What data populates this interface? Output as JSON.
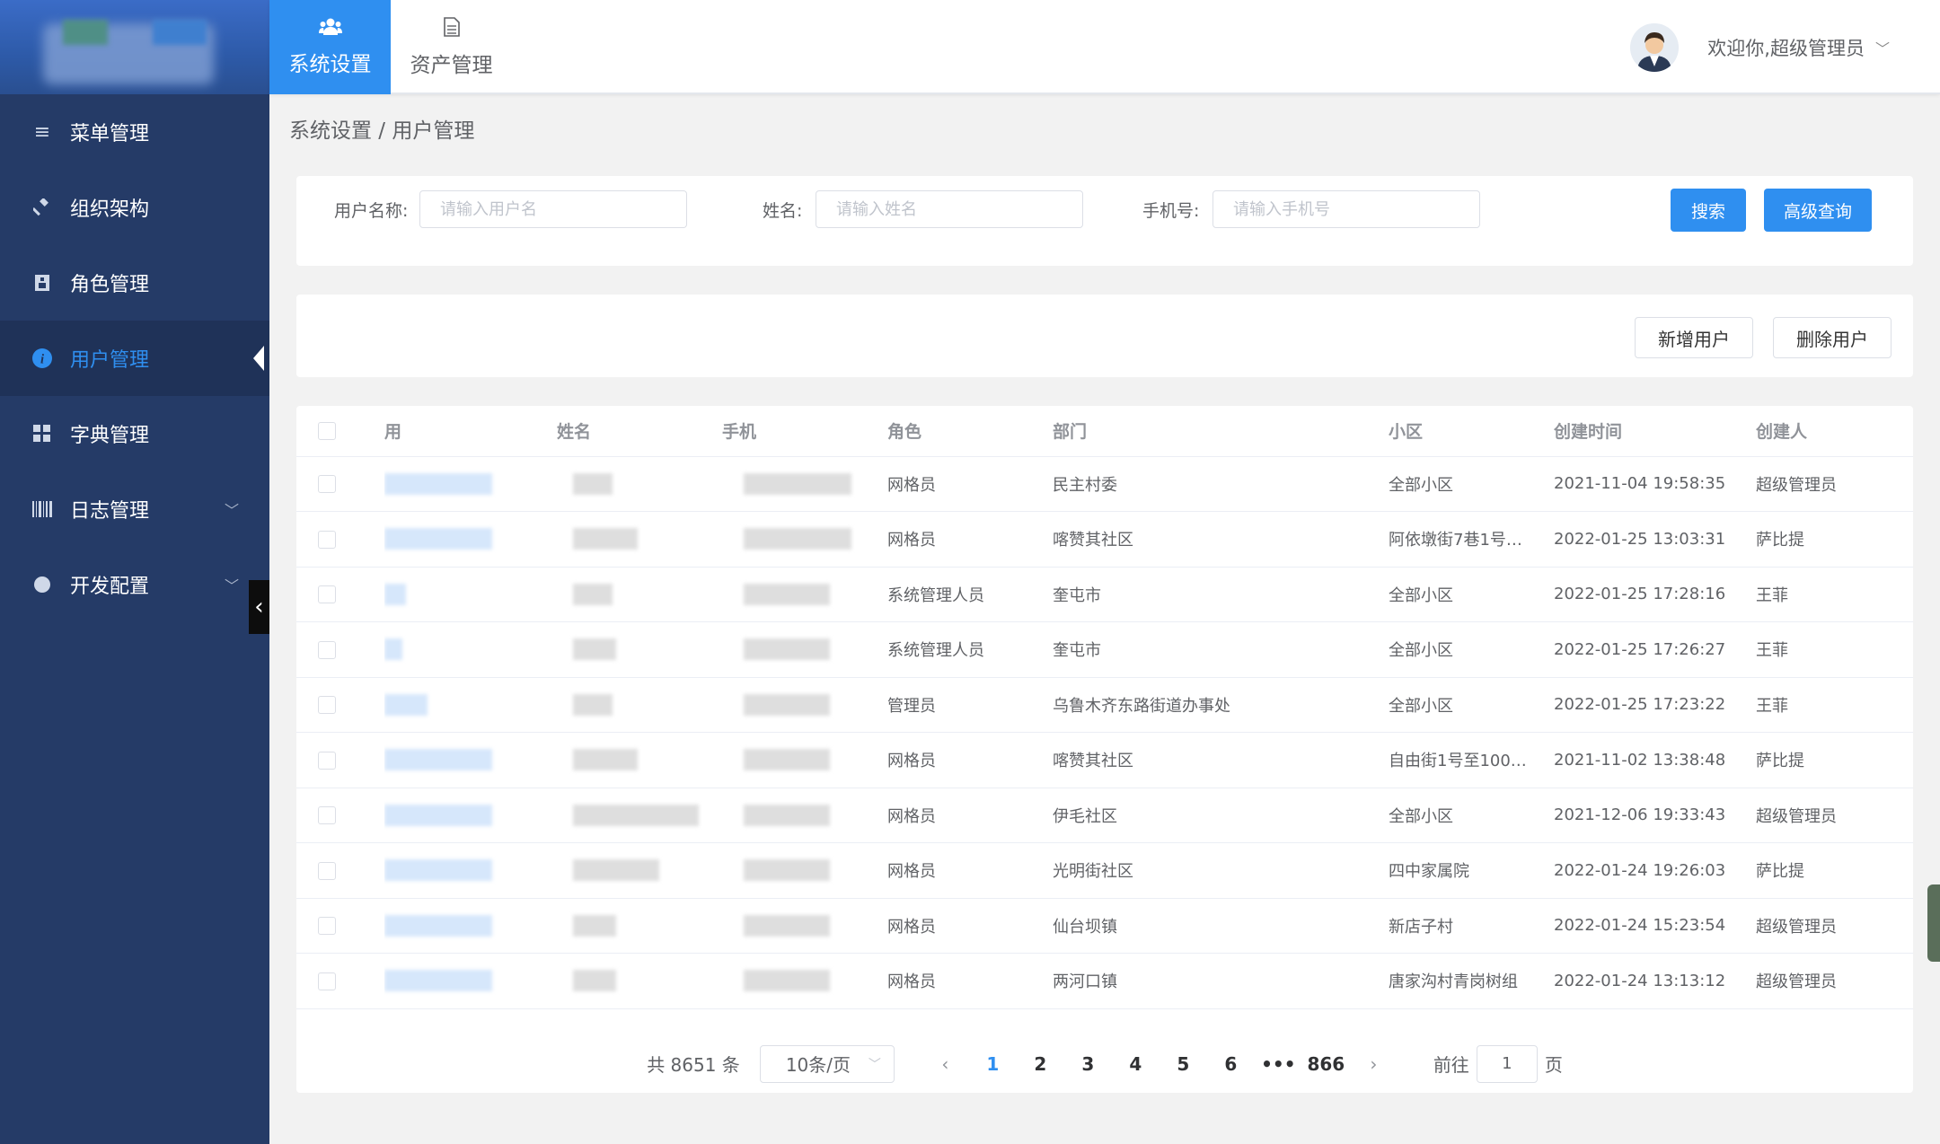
{
  "header": {
    "tabs": [
      {
        "label": "系统设置",
        "icon": "users-icon",
        "active": true
      },
      {
        "label": "资产管理",
        "icon": "document-icon",
        "active": false
      }
    ],
    "welcome": "欢迎你,超级管理员"
  },
  "sidebar": {
    "items": [
      {
        "label": "菜单管理",
        "icon": "menu-icon"
      },
      {
        "label": "组织架构",
        "icon": "gavel-icon"
      },
      {
        "label": "角色管理",
        "icon": "id-card-icon"
      },
      {
        "label": "用户管理",
        "icon": "info-icon",
        "active": true
      },
      {
        "label": "字典管理",
        "icon": "grid-icon"
      },
      {
        "label": "日志管理",
        "icon": "barcode-icon",
        "expandable": true
      },
      {
        "label": "开发配置",
        "icon": "dot-icon",
        "expandable": true
      }
    ]
  },
  "breadcrumb": "系统设置 / 用户管理",
  "search": {
    "username_label": "用户名称:",
    "username_placeholder": "请输入用户名",
    "name_label": "姓名:",
    "name_placeholder": "请输入姓名",
    "phone_label": "手机号:",
    "phone_placeholder": "请输入手机号",
    "search_button": "搜索",
    "advanced_button": "高级查询"
  },
  "actions": {
    "add_user": "新增用户",
    "delete_user": "删除用户"
  },
  "table": {
    "headers": [
      "用",
      "姓名",
      "手机",
      "角色",
      "部门",
      "小区",
      "创建时间",
      "创建人"
    ],
    "rows": [
      {
        "role": "网格员",
        "dept": "民主村委",
        "community": "全部小区",
        "created": "2021-11-04 19:58:35",
        "creator": "超级管理员"
      },
      {
        "role": "网格员",
        "dept": "喀赞其社区",
        "community": "阿依墩街7巷1号…",
        "created": "2022-01-25 13:03:31",
        "creator": "萨比提"
      },
      {
        "role": "系统管理人员",
        "dept": "奎屯市",
        "community": "全部小区",
        "created": "2022-01-25 17:28:16",
        "creator": "王菲"
      },
      {
        "role": "系统管理人员",
        "dept": "奎屯市",
        "community": "全部小区",
        "created": "2022-01-25 17:26:27",
        "creator": "王菲"
      },
      {
        "role": "管理员",
        "dept": "乌鲁木齐东路街道办事处",
        "community": "全部小区",
        "created": "2022-01-25 17:23:22",
        "creator": "王菲"
      },
      {
        "role": "网格员",
        "dept": "喀赞其社区",
        "community": "自由街1号至100…",
        "created": "2021-11-02 13:38:48",
        "creator": "萨比提"
      },
      {
        "role": "网格员",
        "dept": "伊毛社区",
        "community": "全部小区",
        "created": "2021-12-06 19:33:43",
        "creator": "超级管理员"
      },
      {
        "role": "网格员",
        "dept": "光明街社区",
        "community": "四中家属院",
        "created": "2022-01-24 19:26:03",
        "creator": "萨比提"
      },
      {
        "role": "网格员",
        "dept": "仙台坝镇",
        "community": "新店子村",
        "created": "2022-01-24 15:23:54",
        "creator": "超级管理员"
      },
      {
        "role": "网格员",
        "dept": "两河口镇",
        "community": "唐家沟村青岗树组",
        "created": "2022-01-24 13:13:12",
        "creator": "超级管理员"
      }
    ]
  },
  "pagination": {
    "total": "共 8651 条",
    "page_size": "10条/页",
    "pages": [
      "1",
      "2",
      "3",
      "4",
      "5",
      "6",
      "•••",
      "866"
    ],
    "current": "1",
    "goto_label": "前往",
    "goto_value": "1",
    "page_suffix": "页"
  },
  "colors": {
    "sidebar_bg": "#253b67",
    "accent": "#2f8ff0"
  }
}
